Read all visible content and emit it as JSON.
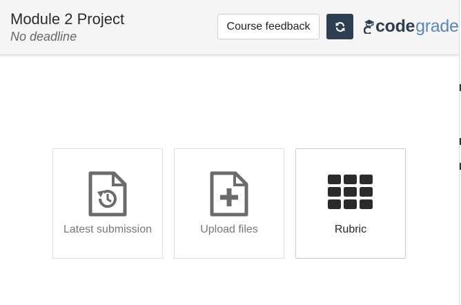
{
  "header": {
    "title": "Module 2 Project",
    "subtitle": "No deadline",
    "feedback_button": "Course feedback",
    "refresh_icon": "refresh-icon",
    "logo": {
      "part1": "code",
      "part2": "grade"
    }
  },
  "cards": [
    {
      "label": "Latest submission",
      "icon": "file-history-icon"
    },
    {
      "label": "Upload files",
      "icon": "file-plus-icon"
    },
    {
      "label": "Rubric",
      "icon": "grid-icon"
    }
  ],
  "colors": {
    "header_bg": "#f5f5f5",
    "refresh_bg": "#2d3e50",
    "logo_dark": "#2d3e50",
    "logo_light": "#5a87b8"
  }
}
